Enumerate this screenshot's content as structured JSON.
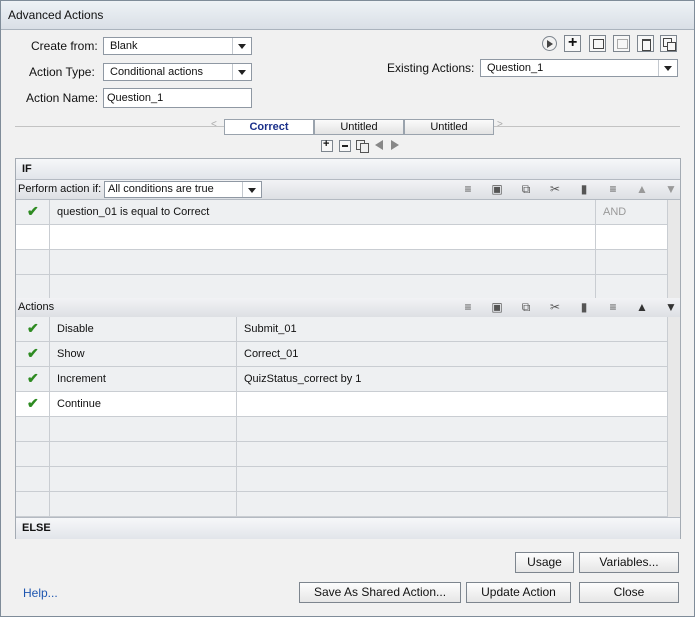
{
  "window": {
    "title": "Advanced Actions"
  },
  "form": {
    "create_from_label": "Create from:",
    "create_from_value": "Blank",
    "action_type_label": "Action Type:",
    "action_type_value": "Conditional actions",
    "action_name_label": "Action Name:",
    "action_name_value": "Question_1",
    "existing_label": "Existing Actions:",
    "existing_value": "Question_1"
  },
  "tabs": [
    "Correct",
    "Untitled",
    "Untitled"
  ],
  "if_section": {
    "title": "IF",
    "perform_label": "Perform action if:",
    "condition_mode": "All conditions are true",
    "conditions": [
      {
        "text": "question_01    is equal to    Correct",
        "op": "AND"
      }
    ]
  },
  "actions_section": {
    "title": "Actions",
    "rows": [
      {
        "action": "Disable",
        "target": "Submit_01"
      },
      {
        "action": "Show",
        "target": "Correct_01"
      },
      {
        "action": "Increment",
        "target": "QuizStatus_correct    by    1"
      },
      {
        "action": "Continue",
        "target": ""
      }
    ]
  },
  "else_section": {
    "title": "ELSE"
  },
  "buttons": {
    "usage": "Usage",
    "variables": "Variables...",
    "help": "Help...",
    "save_shared": "Save As Shared Action...",
    "update": "Update Action",
    "close": "Close"
  }
}
